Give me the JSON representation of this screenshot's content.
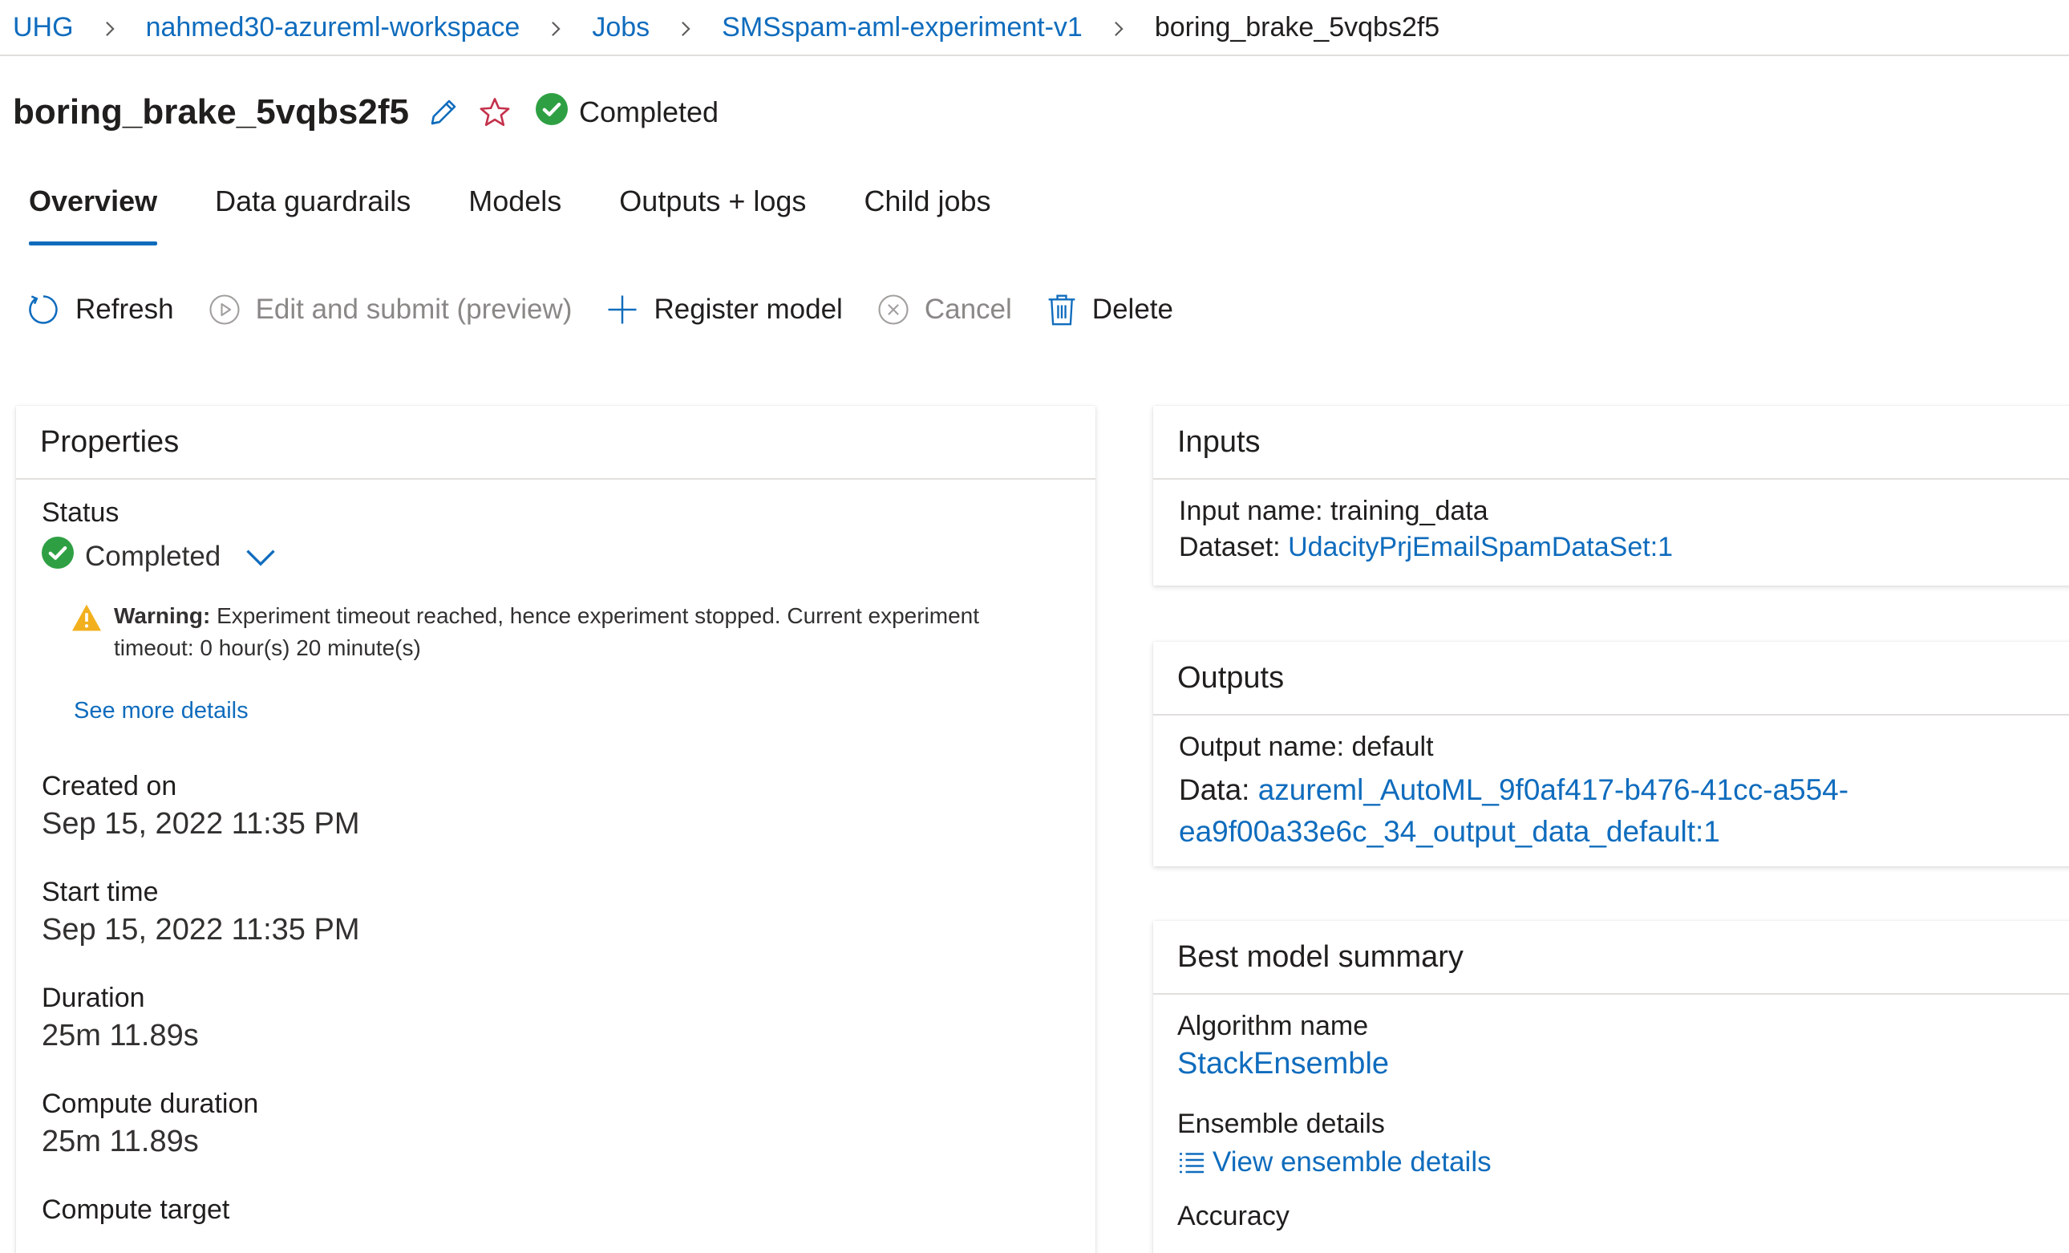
{
  "breadcrumb": {
    "items": [
      "UHG",
      "nahmed30-azureml-workspace",
      "Jobs",
      "SMSspam-aml-experiment-v1"
    ],
    "current": "boring_brake_5vqbs2f5"
  },
  "header": {
    "title": "boring_brake_5vqbs2f5",
    "status": "Completed"
  },
  "tabs": [
    "Overview",
    "Data guardrails",
    "Models",
    "Outputs + logs",
    "Child jobs"
  ],
  "toolbar": {
    "refresh": "Refresh",
    "edit_submit": "Edit and submit (preview)",
    "register_model": "Register model",
    "cancel": "Cancel",
    "delete": "Delete"
  },
  "properties": {
    "title": "Properties",
    "status_label": "Status",
    "status_value": "Completed",
    "warning_prefix": "Warning:",
    "warning_text": "Experiment timeout reached, hence experiment stopped. Current experiment timeout: 0 hour(s) 20 minute(s)",
    "see_more": "See more details",
    "created_on_label": "Created on",
    "created_on_value": "Sep 15, 2022 11:35 PM",
    "start_time_label": "Start time",
    "start_time_value": "Sep 15, 2022 11:35 PM",
    "duration_label": "Duration",
    "duration_value": "25m 11.89s",
    "compute_duration_label": "Compute duration",
    "compute_duration_value": "25m 11.89s",
    "compute_target_label": "Compute target"
  },
  "inputs": {
    "title": "Inputs",
    "input_name_label": "Input name:",
    "input_name_value": "training_data",
    "dataset_label": "Dataset:",
    "dataset_value": "UdacityPrjEmailSpamDataSet:1"
  },
  "outputs": {
    "title": "Outputs",
    "output_name_label": "Output name:",
    "output_name_value": "default",
    "data_label": "Data:",
    "data_value_line1": "azureml_AutoML_9f0af417-b476-41cc-a554-",
    "data_value_line2": "ea9f00a33e6c_34_output_data_default:1"
  },
  "best_model": {
    "title": "Best model summary",
    "algorithm_label": "Algorithm name",
    "algorithm_value": "StackEnsemble",
    "ensemble_label": "Ensemble details",
    "ensemble_link": "View ensemble details",
    "accuracy_label": "Accuracy"
  },
  "colors": {
    "link": "#0f6cbd",
    "success": "#2ea043",
    "warning": "#f2b01e",
    "star": "#c4314b"
  }
}
